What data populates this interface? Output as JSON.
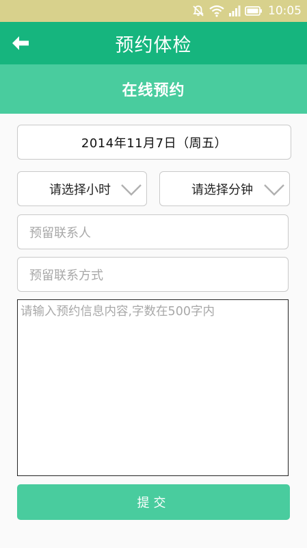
{
  "status_bar": {
    "time": "10:05",
    "icons": [
      "mute-icon",
      "wifi-icon",
      "signal-icon",
      "battery-icon"
    ]
  },
  "header": {
    "title": "预约体检",
    "back_icon": "arrow-left-icon"
  },
  "sub_header": {
    "title": "在线预约"
  },
  "form": {
    "date_value": "2014年11月7日（周五）",
    "hour_select": {
      "value": "请选择小时",
      "icon": "chevron-down-icon"
    },
    "minute_select": {
      "value": "请选择分钟",
      "icon": "chevron-down-icon"
    },
    "contact_person_placeholder": "预留联系人",
    "contact_method_placeholder": "预留联系方式",
    "content_placeholder": "请输入预约信息内容,字数在500字内"
  },
  "submit": {
    "label": "提交"
  },
  "colors": {
    "status_bar": "#d8d18c",
    "app_bar": "#16b57e",
    "sub_header": "#49cc9e",
    "submit_button": "#49cc9e",
    "placeholder": "#a8a8a8"
  }
}
